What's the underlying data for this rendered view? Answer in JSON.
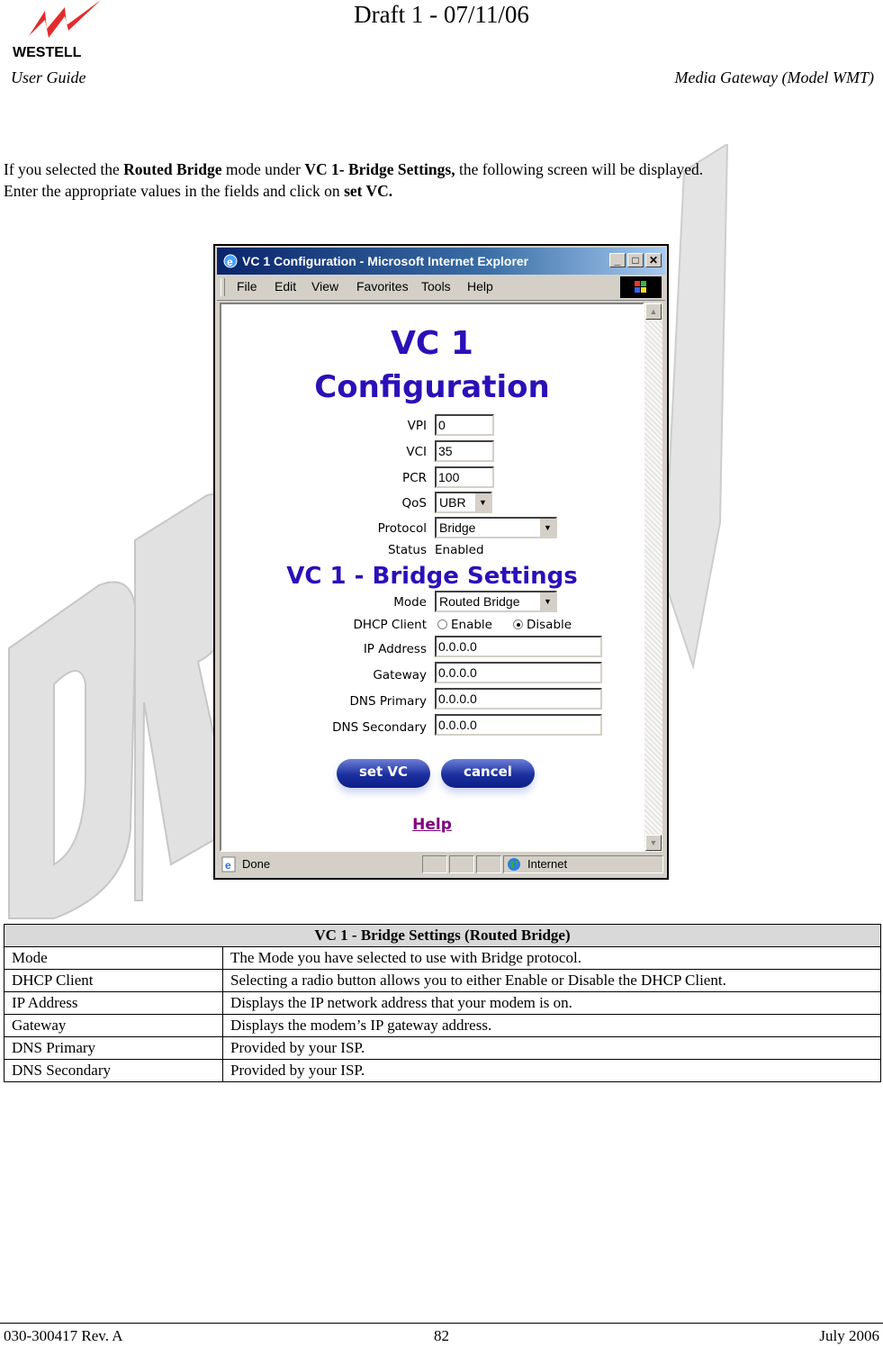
{
  "header": {
    "draft_label": "Draft 1 - 07/11/06",
    "logo_text": "WESTELL",
    "left_title": "User Guide",
    "right_title": "Media Gateway (Model WMT)"
  },
  "watermark": "DRAFT",
  "intro": {
    "p1_a": "If you selected the ",
    "p1_b": "Routed Bridge",
    "p1_c": " mode under ",
    "p1_d": "VC 1- Bridge Settings,",
    "p1_e": " the following screen will be displayed.",
    "p2_a": "Enter the appropriate values in the fields and click on ",
    "p2_b": "set VC."
  },
  "browser": {
    "title": "VC 1 Configuration - Microsoft Internet Explorer",
    "menu": [
      "File",
      "Edit",
      "View",
      "Favorites",
      "Tools",
      "Help"
    ],
    "status_text": "Done",
    "zone_text": "Internet"
  },
  "page": {
    "heading1": "VC 1",
    "heading2": "Configuration",
    "section_heading": "VC 1 - Bridge Settings",
    "fields": {
      "vpi": {
        "label": "VPI",
        "value": "0"
      },
      "vci": {
        "label": "VCI",
        "value": "35"
      },
      "pcr": {
        "label": "PCR",
        "value": "100"
      },
      "qos": {
        "label": "QoS",
        "value": "UBR"
      },
      "protocol": {
        "label": "Protocol",
        "value": "Bridge"
      },
      "status": {
        "label": "Status",
        "value": "Enabled"
      },
      "mode": {
        "label": "Mode",
        "value": "Routed Bridge"
      },
      "dhcp": {
        "label": "DHCP Client",
        "option_enable": "Enable",
        "option_disable": "Disable",
        "selected": "Disable"
      },
      "ip": {
        "label": "IP Address",
        "value": "0.0.0.0"
      },
      "gateway": {
        "label": "Gateway",
        "value": "0.0.0.0"
      },
      "dns1": {
        "label": "DNS Primary",
        "value": "0.0.0.0"
      },
      "dns2": {
        "label": "DNS Secondary",
        "value": "0.0.0.0"
      }
    },
    "set_vc_button": "set VC",
    "cancel_button": "cancel",
    "help_link": "Help"
  },
  "table": {
    "title": "VC 1 - Bridge Settings (Routed Bridge)",
    "rows": [
      {
        "field": "Mode",
        "desc": "The Mode you have selected to use with Bridge protocol."
      },
      {
        "field": "DHCP Client",
        "desc": "Selecting a radio button allows you to either Enable or Disable the DHCP Client."
      },
      {
        "field": "IP Address",
        "desc": "Displays the IP network address that your modem is on."
      },
      {
        "field": "Gateway",
        "desc": "Displays the modem’s IP gateway address."
      },
      {
        "field": "DNS Primary",
        "desc": "Provided by your ISP."
      },
      {
        "field": "DNS Secondary",
        "desc": "Provided by your ISP."
      }
    ]
  },
  "footer": {
    "doc_number": "030-300417 Rev. A",
    "page_number": "82",
    "date": "July 2006"
  }
}
